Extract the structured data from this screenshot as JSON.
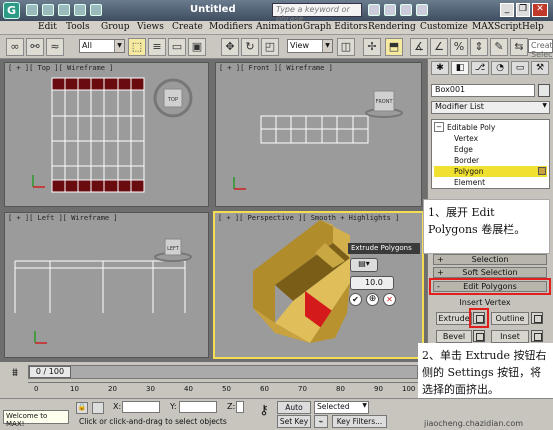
{
  "titlebar": {
    "title": "Untitled",
    "search_placeholder": "Type a keyword or phrase"
  },
  "menu": [
    "Edit",
    "Tools",
    "Group",
    "Views",
    "Create",
    "Modifiers",
    "Animation",
    "Graph Editors",
    "Rendering",
    "Customize",
    "MAXScript",
    "Help"
  ],
  "toolbar": {
    "filter_value": "All",
    "refcoord_value": "View",
    "selection_set_placeholder": "Create Selection Se"
  },
  "viewports": {
    "top": "[ + ][ Top ][ Wireframe ]",
    "front": "[ + ][ Front ][ Wireframe ]",
    "left": "[ + ][ Left ][ Wireframe ]",
    "perspective": "[ + ][ Perspective ][ Smooth + Highlights ]",
    "cube_top": "TOP",
    "cube_front": "FRONT",
    "cube_left": "LEFT",
    "caddy_title": "Extrude Polygons",
    "caddy_value": "10.0"
  },
  "cmdpanel": {
    "object_name": "Box001",
    "modifier_list": "Modifier List",
    "stack": [
      "Editable Poly",
      "Vertex",
      "Edge",
      "Border",
      "Polygon",
      "Element"
    ],
    "selected_stack_item": "Polygon",
    "rollouts": {
      "selection": "Selection",
      "soft_selection": "Soft Selection",
      "edit_polygons": "Edit Polygons"
    },
    "buttons": {
      "insert_vertex": "Insert Vertex",
      "extrude": "Extrude",
      "outline": "Outline",
      "bevel": "Bevel",
      "inset": "Inset"
    },
    "plus": "+",
    "minus": "-"
  },
  "annotations": {
    "note1": "1、展开 Edit Polygons 卷展栏。",
    "note2": "2、单击 Extrude 按钮右侧的 Settings 按钮，将选择的面挤出。"
  },
  "timeline": {
    "frame_label": "0 / 100",
    "ticks": [
      "0",
      "10",
      "20",
      "30",
      "40",
      "50",
      "60",
      "70",
      "80",
      "90",
      "100"
    ]
  },
  "statusbar": {
    "maxscript": "Welcome to MAX!",
    "prompt": "Click or click-and-drag to select objects",
    "x_label": "X:",
    "y_label": "Y:",
    "z_label": "Z:",
    "autokey": "Auto Key",
    "setkey": "Set Key",
    "selected_value": "Selected",
    "keyfilters": "Key Filters..."
  },
  "watermark": "jiaocheng.chazidian.com",
  "colors": {
    "active_border": "#f5dc55",
    "highlight": "#e0201d",
    "polygon_red": "#c50e0e",
    "object_gold": "#c8a23e",
    "selected_stack": "#f0e030"
  }
}
